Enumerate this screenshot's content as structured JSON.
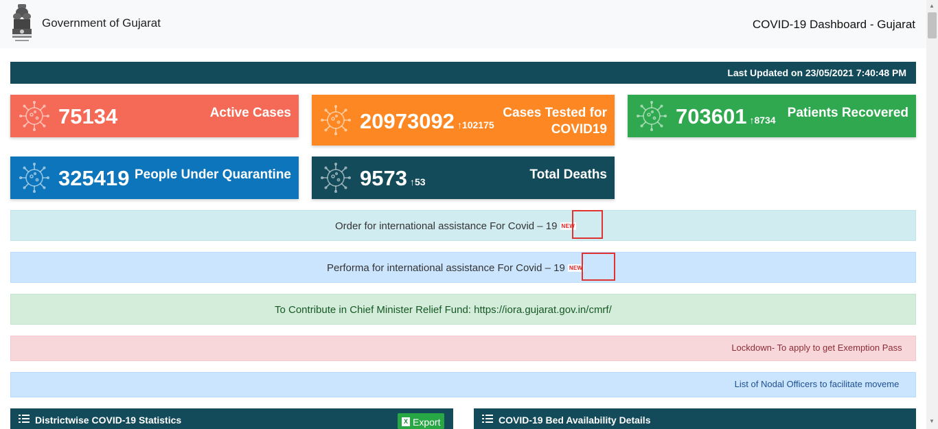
{
  "header": {
    "gov_title": "Government of Gujarat",
    "dashboard_title": "COVID-19 Dashboard - Gujarat"
  },
  "last_updated": "Last Updated on 23/05/2021 7:40:48 PM",
  "stats": {
    "active": {
      "value": "75134",
      "label": "Active Cases",
      "color": "#f46a56"
    },
    "tested": {
      "value": "20973092",
      "delta": "102175",
      "label_line1": "Cases Tested for",
      "label_line2": "COVID19",
      "color": "#fd8722"
    },
    "recovered": {
      "value": "703601",
      "delta": "8734",
      "label": "Patients Recovered",
      "color": "#2fa84f"
    },
    "quarantine": {
      "value": "325419",
      "label": "People Under Quarantine",
      "color": "#0c75bb"
    },
    "deaths": {
      "value": "9573",
      "delta": "53",
      "label": "Total Deaths",
      "color": "#134b5a"
    }
  },
  "alerts": {
    "order": "Order for international assistance For Covid – 19",
    "performa": "Performa for international assistance For Covid – 19",
    "cmrf": "To Contribute in Chief Minister Relief Fund: https://iora.gujarat.gov.in/cmrf/",
    "lockdown": "Lockdown- To apply to get Exemption Pass",
    "nodal": "List of Nodal Officers to facilitate moveme",
    "new_badge": "NEW"
  },
  "panels": {
    "district_title": "Districtwise COVID-19 Statistics",
    "export_label": "Export",
    "export_icon_text": "X",
    "bed_title": "COVID-19 Bed Availability Details"
  },
  "icons": {
    "emblem": "national-emblem-icon",
    "virus": "virus-icon",
    "arrow": "arrow-up-icon",
    "list": "list-icon",
    "excel": "excel-icon"
  }
}
